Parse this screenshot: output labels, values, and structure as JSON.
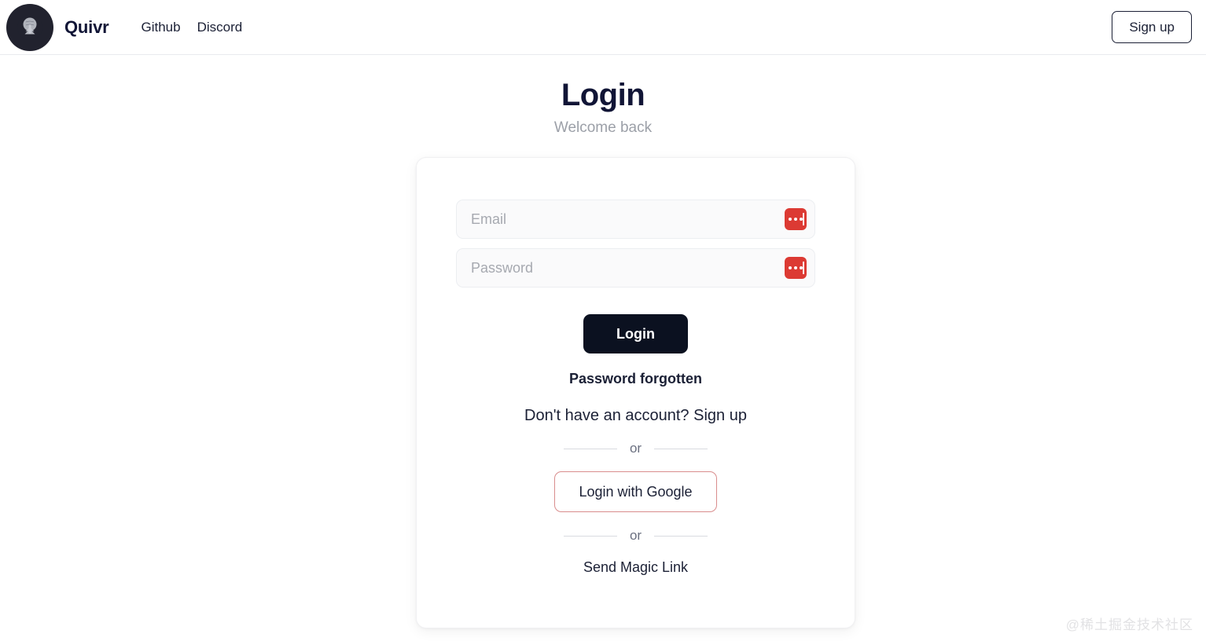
{
  "header": {
    "logo_icon": "quivr-tree-logo-icon",
    "brand_name": "Quivr",
    "nav": [
      {
        "label": "Github"
      },
      {
        "label": "Discord"
      }
    ],
    "signup_label": "Sign up"
  },
  "page": {
    "title": "Login",
    "subtitle": "Welcome back"
  },
  "form": {
    "email": {
      "value": "",
      "placeholder": "Email",
      "manager_icon": "password-manager-icon"
    },
    "password": {
      "value": "",
      "placeholder": "Password",
      "manager_icon": "password-manager-icon"
    },
    "submit_label": "Login",
    "forgot_label": "Password forgotten",
    "signup_prompt": "Don't have an account? Sign up",
    "divider_label_1": "or",
    "google_label": "Login with Google",
    "divider_label_2": "or",
    "magic_link_label": "Send Magic Link"
  },
  "watermark": "@稀土掘金技术社区",
  "colors": {
    "accent_dark": "#0b1120",
    "google_border": "#d98d8d",
    "password_manager_red": "#dc3a33",
    "muted_text": "#9ca0a8"
  }
}
